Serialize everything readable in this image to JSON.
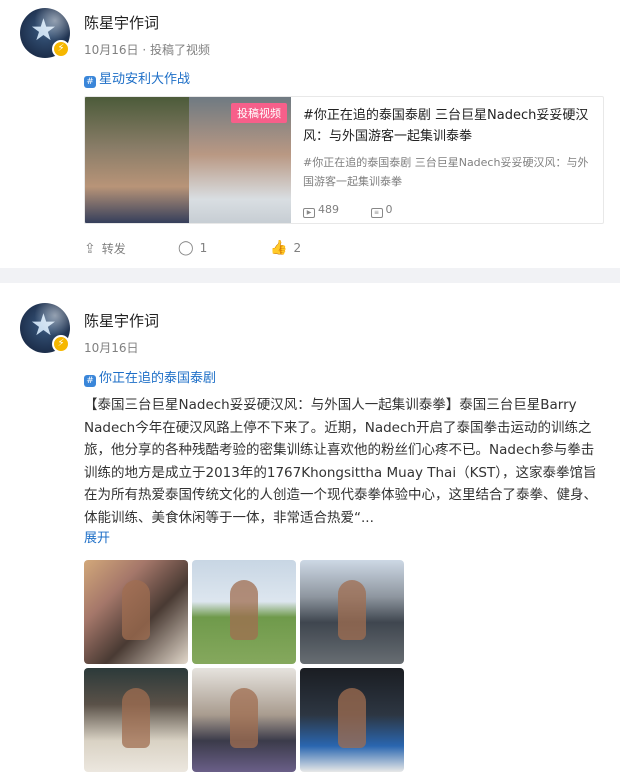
{
  "post1": {
    "author": "陈星宇作词",
    "date": "10月16日",
    "action_text": "投稿了视频",
    "topic": "星动安利大作战",
    "video": {
      "badge": "投稿视频",
      "title": "#你正在追的泰国泰剧 三台巨星Nadech妥妥硬汉风：与外国游客一起集训泰拳",
      "desc": "#你正在追的泰国泰剧 三台巨星Nadech妥妥硬汉风：与外国游客一起集训泰拳",
      "views": "489",
      "comments": "0"
    },
    "actions": {
      "repost": "转发",
      "comments": "1",
      "likes": "2"
    }
  },
  "post2": {
    "author": "陈星宇作词",
    "date": "10月16日",
    "topic": "你正在追的泰国泰剧",
    "text": "【泰国三台巨星Nadech妥妥硬汉风：与外国人一起集训泰拳】泰国三台巨星Barry Nadech今年在硬汉风路上停不下来了。近期，Nadech开启了泰国拳击运动的训练之旅，他分享的各种残酷考验的密集训练让喜欢他的粉丝们心疼不已。Nadech参与拳击训练的地方是成立于2013年的1767Khongsittha Muay Thai（KST），这家泰拳馆旨在为所有热爱泰国传统文化的人创造一个现代泰拳体验中心，这里结合了泰拳、健身、体能训练、美食休闲等于一体，非常适合热爱“...",
    "expand": "展开"
  }
}
